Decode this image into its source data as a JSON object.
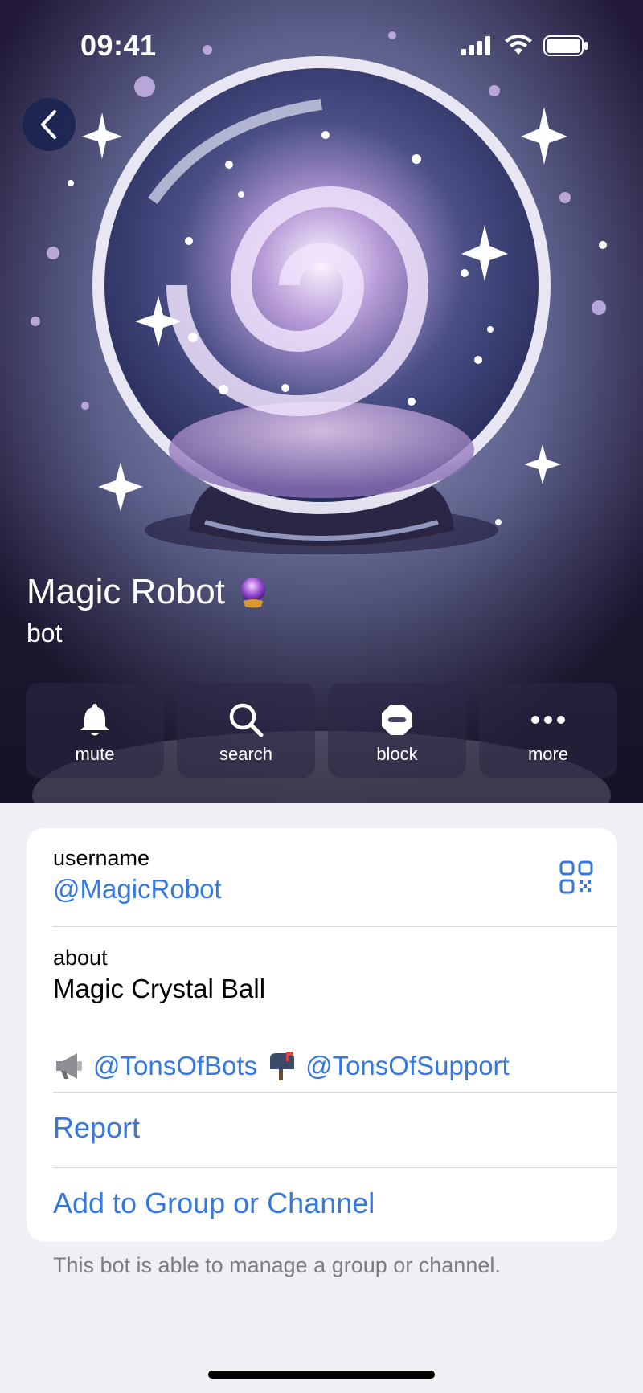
{
  "status_bar": {
    "time": "09:41"
  },
  "profile": {
    "name": "Magic Robot",
    "subtitle": "bot"
  },
  "actions": [
    {
      "label": "mute",
      "icon": "bell-icon"
    },
    {
      "label": "search",
      "icon": "search-icon"
    },
    {
      "label": "block",
      "icon": "block-icon"
    },
    {
      "label": "more",
      "icon": "more-icon"
    }
  ],
  "info": {
    "username_label": "username",
    "username_value": "@MagicRobot",
    "about_label": "about",
    "about_value": "Magic Crystal Ball",
    "link1": "@TonsOfBots",
    "link2": "@TonsOfSupport",
    "report": "Report",
    "add_to_group": "Add to Group or Channel"
  },
  "footer_note": "This bot is able to manage a group or channel.",
  "colors": {
    "accent": "#3478e0",
    "background": "#efeff4"
  }
}
